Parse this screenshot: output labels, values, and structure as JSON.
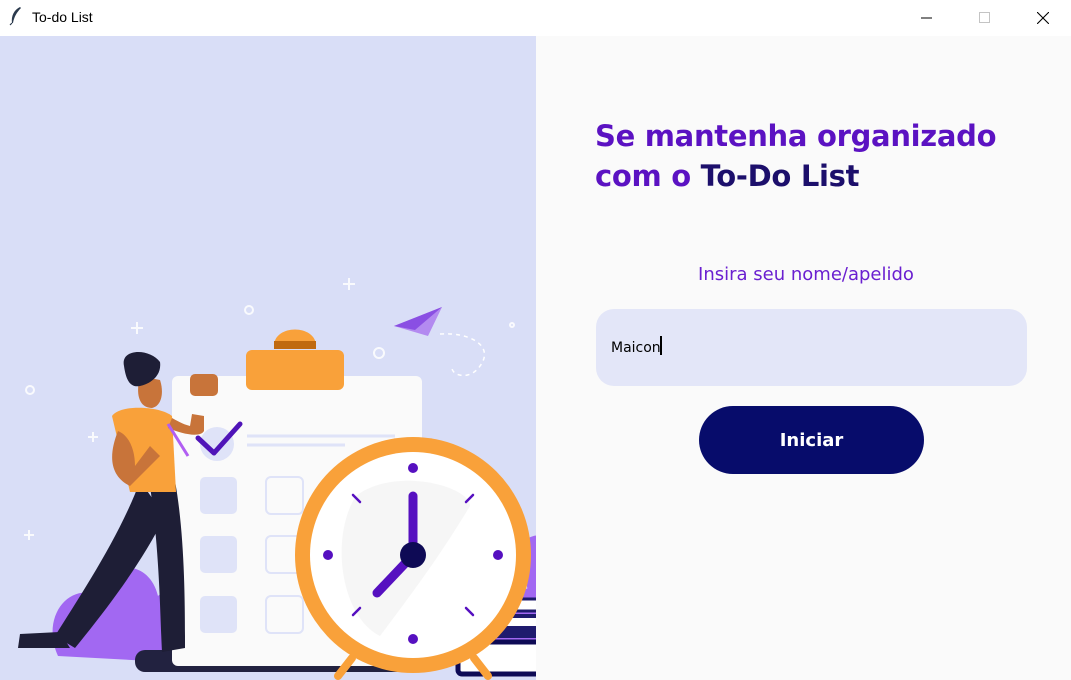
{
  "window": {
    "title": "To-do List",
    "icon": "feather-icon",
    "controls": [
      "minimize-icon",
      "maximize-icon",
      "close-icon"
    ]
  },
  "headline": {
    "line1": "Se mantenha organizado",
    "line2_prefix": "com o ",
    "line2_brand": "To-Do List"
  },
  "form": {
    "label": "Insira seu nome/apelido",
    "name_value": "Maicon",
    "submit_label": "Iniciar"
  },
  "illustration": {
    "name": "person-checklist-clock-illustration"
  },
  "colors": {
    "accent_purple": "#5b12c2",
    "brand_navy": "#1c0f6b",
    "button_navy": "#070c6b",
    "left_background": "#d9def7",
    "input_background": "#e3e6f8",
    "clock_orange": "#f9a13a"
  }
}
